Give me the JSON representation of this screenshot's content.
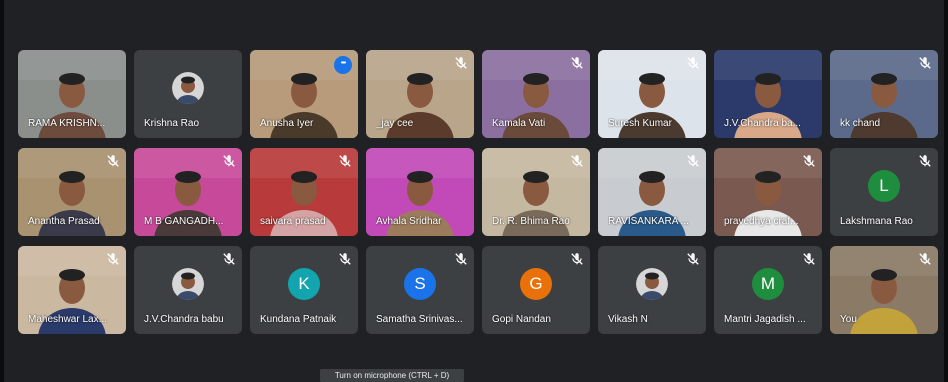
{
  "participants": [
    {
      "name": "RAMA KRISHN...",
      "muted": false,
      "bg": "#8a8f8c",
      "person": "#6d4c3d"
    },
    {
      "name": "Krishna Rao",
      "muted": false,
      "tile_bg": "#3c4043",
      "photo_avatar": true
    },
    {
      "name": "Anusha Iyer",
      "muted": false,
      "speaking": true,
      "more": true,
      "bg": "#b79b7a",
      "person": "#4a3a2a"
    },
    {
      "name": "_jay cee",
      "muted": true,
      "bg": "#b8a58a",
      "person": "#5b3b2b"
    },
    {
      "name": "Kamala Vati",
      "muted": true,
      "bg": "#8b6fa0",
      "person": "#6a4a3a"
    },
    {
      "name": "Suresh Kumar",
      "muted": true,
      "bg": "#dde3ea",
      "person": "#4b3a30"
    },
    {
      "name": "J.V.Chandra ba...",
      "muted": false,
      "bg": "#2b3a6b",
      "person": "#d8a888"
    },
    {
      "name": "kk chand",
      "muted": true,
      "bg": "#5b6a8a",
      "person": "#4e3a2e"
    },
    {
      "name": "Anantha Prasad",
      "muted": true,
      "bg": "#a89270",
      "person": "#3a3a4a"
    },
    {
      "name": "M B GANGADH...",
      "muted": true,
      "bg": "#c74a9a",
      "person": "#4a3a3a"
    },
    {
      "name": "saivara prasad",
      "muted": true,
      "bg": "#b83a3a",
      "person": "#d4a4a4"
    },
    {
      "name": "Avhala Sridhar",
      "muted": false,
      "bg": "#c24ab8",
      "person": "#9b7b5b"
    },
    {
      "name": "Dr. R. Bhima Rao",
      "muted": true,
      "bg": "#c5b8a0",
      "person": "#7a6a5a"
    },
    {
      "name": "RAVISANKARA ...",
      "muted": true,
      "bg": "#c8ccd0",
      "person": "#2a5a8a"
    },
    {
      "name": "pravedhya craf...",
      "muted": true,
      "bg": "#7a5a50",
      "person": "#e8e8e8"
    },
    {
      "name": "Lakshmana Rao",
      "muted": true,
      "tile_bg": "#3c4043",
      "initial": "L",
      "avatar_color": "#1e8e3e"
    },
    {
      "name": "Maheshwar Lax...",
      "muted": true,
      "bg": "#cbb8a0",
      "person": "#2a3a6a"
    },
    {
      "name": "J.V.Chandra babu",
      "muted": true,
      "tile_bg": "#3c4043",
      "photo_avatar": true
    },
    {
      "name": "Kundana Patnaik",
      "muted": true,
      "tile_bg": "#3c4043",
      "initial": "K",
      "avatar_color": "#12a4af"
    },
    {
      "name": "Samatha Srinivas...",
      "muted": true,
      "tile_bg": "#3c4043",
      "initial": "S",
      "avatar_color": "#1a73e8"
    },
    {
      "name": "Gopi Nandan",
      "muted": true,
      "tile_bg": "#3c4043",
      "initial": "G",
      "avatar_color": "#e8710a"
    },
    {
      "name": "Vikash N",
      "muted": true,
      "tile_bg": "#3c4043",
      "photo_avatar": true
    },
    {
      "name": "Mantri Jagadish ...",
      "muted": true,
      "tile_bg": "#3c4043",
      "initial": "M",
      "avatar_color": "#1e8e3e"
    },
    {
      "name": "You",
      "muted": true,
      "bg": "#8a7a66",
      "person": "#c2a23a"
    }
  ],
  "tooltip": "Turn on microphone (CTRL + D)",
  "colors": {
    "background": "#202124",
    "tile": "#3c4043",
    "speaking_border": "#8ab4f8"
  }
}
